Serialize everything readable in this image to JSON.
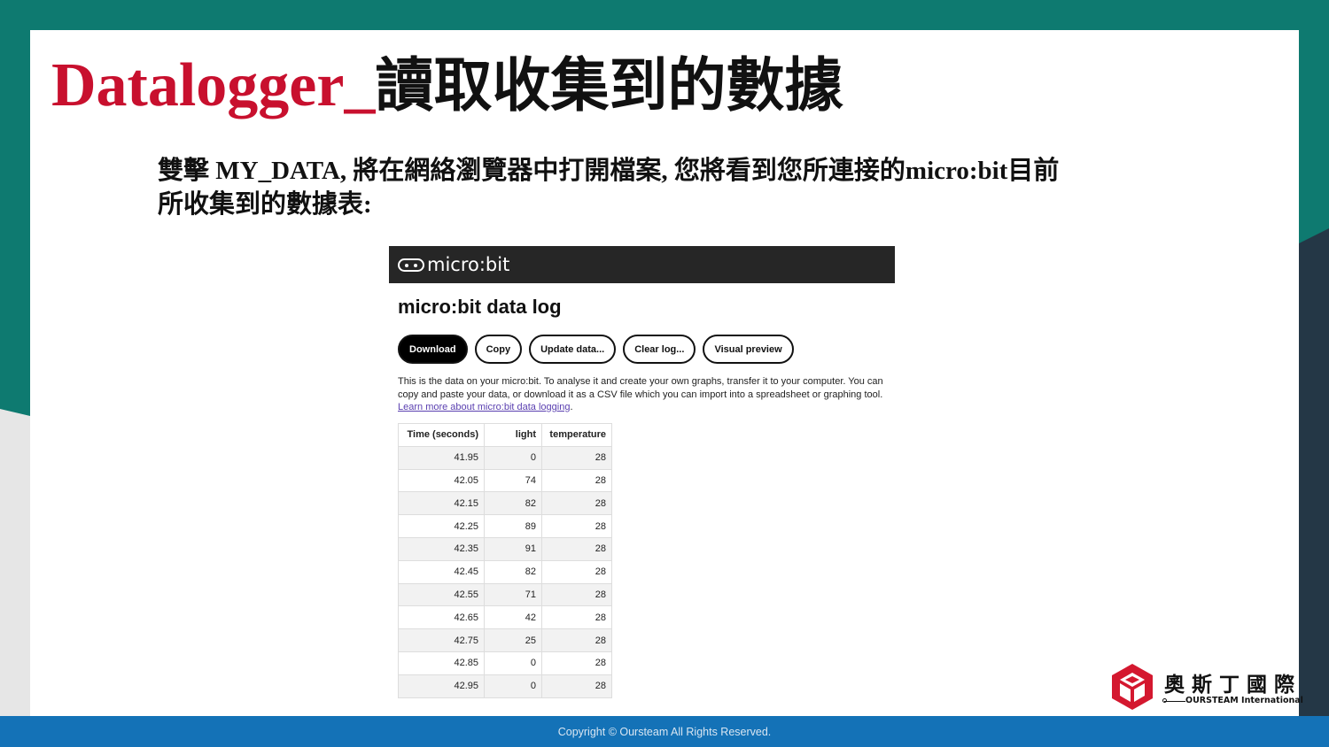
{
  "slide": {
    "title_en": "Datalogger_",
    "title_zh": "讀取收集到的數據",
    "description_line1": "雙擊 MY_DATA, 將在網絡瀏覽器中打開檔案, 您將看到您所連接的micro:bit目前",
    "description_line2": "所收集到的數據表:"
  },
  "microbit_page": {
    "logo_text": "micro:bit",
    "heading": "micro:bit data log",
    "buttons": {
      "download": "Download",
      "copy": "Copy",
      "update": "Update data...",
      "clear": "Clear log...",
      "visual": "Visual preview"
    },
    "paragraph": "This is the data on your micro:bit. To analyse it and create your own graphs, transfer it to your computer. You can copy and paste your data, or download it as a CSV file which you can import into a spreadsheet or graphing tool. ",
    "link_text": "Learn more about micro:bit data logging",
    "paragraph_end": ".",
    "table": {
      "headers": [
        "Time (seconds)",
        "light",
        "temperature"
      ],
      "rows": [
        [
          "41.95",
          "0",
          "28"
        ],
        [
          "42.05",
          "74",
          "28"
        ],
        [
          "42.15",
          "82",
          "28"
        ],
        [
          "42.25",
          "89",
          "28"
        ],
        [
          "42.35",
          "91",
          "28"
        ],
        [
          "42.45",
          "82",
          "28"
        ],
        [
          "42.55",
          "71",
          "28"
        ],
        [
          "42.65",
          "42",
          "28"
        ],
        [
          "42.75",
          "25",
          "28"
        ],
        [
          "42.85",
          "0",
          "28"
        ],
        [
          "42.95",
          "0",
          "28"
        ]
      ]
    }
  },
  "brand": {
    "name_zh": "奧斯丁國際",
    "name_en": "OURSTEAM International"
  },
  "footer": {
    "copyright": "Copyright © Oursteam All Rights Reserved."
  },
  "colors": {
    "teal": "#0e7a70",
    "dark_navy": "#243746",
    "title_red": "#c8102e",
    "footer_blue": "#1472b7"
  }
}
